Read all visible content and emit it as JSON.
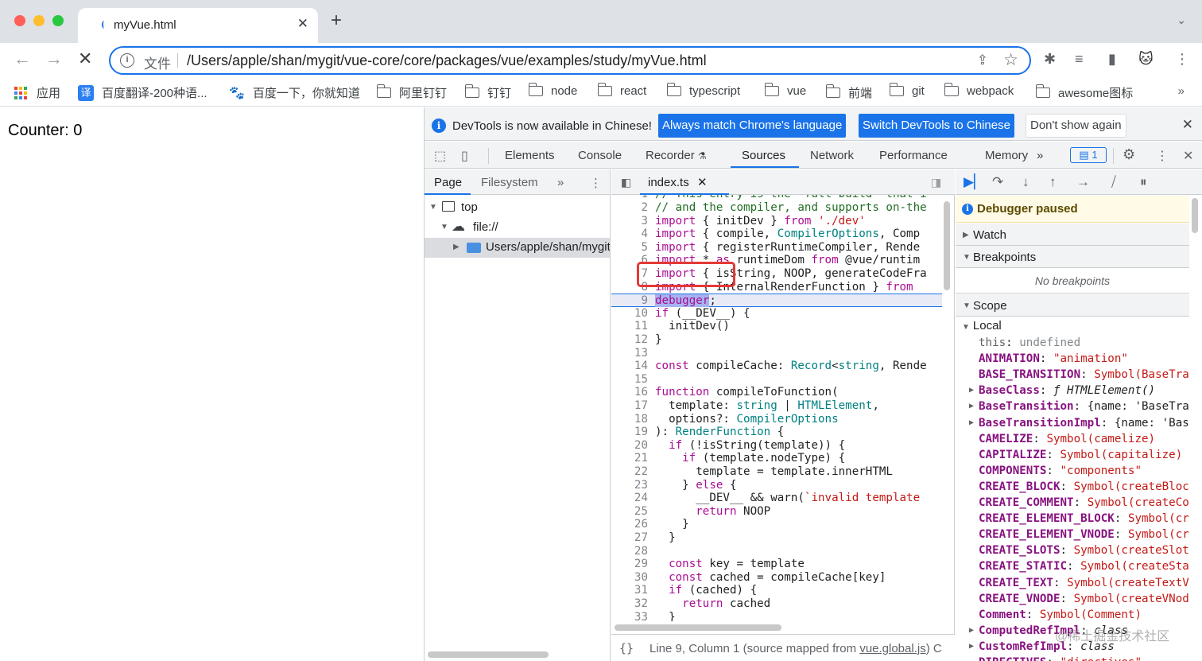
{
  "browser": {
    "tab_title": "myVue.html",
    "url_label": "文件",
    "url": "/Users/apple/shan/mygit/vue-core/core/packages/vue/examples/study/myVue.html"
  },
  "bookmarks": {
    "items": [
      {
        "label": "应用",
        "icon": "apps-grid-icon"
      },
      {
        "label": "百度翻译-200种语...",
        "icon": "fanyi-icon"
      },
      {
        "label": "百度一下，你就知道",
        "icon": "baidu-paw-icon"
      },
      {
        "label": "阿里钉钉",
        "icon": "folder-icon"
      },
      {
        "label": "钉钉",
        "icon": "folder-icon"
      },
      {
        "label": "node",
        "icon": "folder-icon"
      },
      {
        "label": "react",
        "icon": "folder-icon"
      },
      {
        "label": "typescript",
        "icon": "folder-icon"
      },
      {
        "label": "vue",
        "icon": "folder-icon"
      },
      {
        "label": "前端",
        "icon": "folder-icon"
      },
      {
        "label": "git",
        "icon": "folder-icon"
      },
      {
        "label": "webpack",
        "icon": "folder-icon"
      },
      {
        "label": "awesome图标",
        "icon": "folder-icon"
      }
    ],
    "more": "»",
    "fanyi_glyph": "译"
  },
  "page": {
    "counter_text": "Counter: 0"
  },
  "devtools": {
    "infobar": {
      "message": "DevTools is now available in Chinese!",
      "btn_match": "Always match Chrome's language",
      "btn_switch": "Switch DevTools to Chinese",
      "btn_dismiss": "Don't show again"
    },
    "tabs": [
      "Elements",
      "Console",
      "Recorder",
      "Sources",
      "Network",
      "Performance",
      "Memory"
    ],
    "active_tab": "Sources",
    "recorder_icon": "flask-icon",
    "message_count": "1",
    "navigator": {
      "tabs": [
        "Page",
        "Filesystem"
      ],
      "tree": [
        {
          "label": "top",
          "icon": "frame-icon"
        },
        {
          "label": "file://",
          "icon": "cloud-icon"
        },
        {
          "label": "Users/apple/shan/mygit/vue",
          "icon": "folder-icon"
        }
      ]
    },
    "editor": {
      "file_tab": "index.ts",
      "lines": [
        {
          "n": "1",
          "text": "// This entry is the \"full-build\" that i"
        },
        {
          "n": "2",
          "text": "// and the compiler, and supports on-the"
        },
        {
          "n": "3",
          "text": "import { initDev } from './dev'"
        },
        {
          "n": "4",
          "text": "import { compile, CompilerOptions, Comp"
        },
        {
          "n": "5",
          "text": "import { registerRuntimeCompiler, Rende"
        },
        {
          "n": "6",
          "text": "import * as runtimeDom from '@vue/runtim"
        },
        {
          "n": "7",
          "text": "import { isString, NOOP, generateCodeFra"
        },
        {
          "n": "8",
          "text": "import { InternalRenderFunction } from"
        },
        {
          "n": "9",
          "text": "debugger;"
        },
        {
          "n": "10",
          "text": "if (__DEV__) {"
        },
        {
          "n": "11",
          "text": "  initDev()"
        },
        {
          "n": "12",
          "text": "}"
        },
        {
          "n": "13",
          "text": ""
        },
        {
          "n": "14",
          "text": "const compileCache: Record<string, Rende"
        },
        {
          "n": "15",
          "text": ""
        },
        {
          "n": "16",
          "text": "function compileToFunction("
        },
        {
          "n": "17",
          "text": "  template: string | HTMLElement,"
        },
        {
          "n": "18",
          "text": "  options?: CompilerOptions"
        },
        {
          "n": "19",
          "text": "): RenderFunction {"
        },
        {
          "n": "20",
          "text": "  if (!isString(template)) {"
        },
        {
          "n": "21",
          "text": "    if (template.nodeType) {"
        },
        {
          "n": "22",
          "text": "      template = template.innerHTML"
        },
        {
          "n": "23",
          "text": "    } else {"
        },
        {
          "n": "24",
          "text": "      __DEV__ && warn(`invalid template"
        },
        {
          "n": "25",
          "text": "      return NOOP"
        },
        {
          "n": "26",
          "text": "    }"
        },
        {
          "n": "27",
          "text": "  }"
        },
        {
          "n": "28",
          "text": ""
        },
        {
          "n": "29",
          "text": "  const key = template"
        },
        {
          "n": "30",
          "text": "  const cached = compileCache[key]"
        },
        {
          "n": "31",
          "text": "  if (cached) {"
        },
        {
          "n": "32",
          "text": "    return cached"
        },
        {
          "n": "33",
          "text": "  }"
        }
      ],
      "paused_line": "9",
      "status_braces": "{}",
      "status_position": "Line 9, Column 1",
      "status_source_prefix": "(source mapped from ",
      "status_source_link": "vue.global.js",
      "status_source_suffix": ") C"
    },
    "sidebar": {
      "paused_text": "Debugger paused",
      "sections": {
        "watch": "Watch",
        "breakpoints": "Breakpoints",
        "no_breakpoints": "No breakpoints",
        "scope": "Scope",
        "local": "Local"
      },
      "scope_items": [
        {
          "name": "this",
          "value": "undefined",
          "expandable": false,
          "kind": "undef",
          "plain": true
        },
        {
          "name": "ANIMATION",
          "value": "\"animation\"",
          "expandable": false,
          "kind": "str"
        },
        {
          "name": "BASE_TRANSITION",
          "value": "Symbol(BaseTransition)",
          "expandable": false,
          "kind": "sym"
        },
        {
          "name": "BaseClass",
          "value": "ƒ HTMLElement()",
          "expandable": true,
          "kind": "fn"
        },
        {
          "name": "BaseTransition",
          "value": "{name: 'BaseTransition'",
          "expandable": true,
          "kind": "obj"
        },
        {
          "name": "BaseTransitionImpl",
          "value": "{name: 'BaseTransition'",
          "expandable": true,
          "kind": "obj"
        },
        {
          "name": "CAMELIZE",
          "value": "Symbol(camelize)",
          "expandable": false,
          "kind": "sym"
        },
        {
          "name": "CAPITALIZE",
          "value": "Symbol(capitalize)",
          "expandable": false,
          "kind": "sym"
        },
        {
          "name": "COMPONENTS",
          "value": "\"components\"",
          "expandable": false,
          "kind": "str"
        },
        {
          "name": "CREATE_BLOCK",
          "value": "Symbol(createBlock)",
          "expandable": false,
          "kind": "sym"
        },
        {
          "name": "CREATE_COMMENT",
          "value": "Symbol(createComment)",
          "expandable": false,
          "kind": "sym"
        },
        {
          "name": "CREATE_ELEMENT_BLOCK",
          "value": "Symbol(createElementBlock)",
          "expandable": false,
          "kind": "sym"
        },
        {
          "name": "CREATE_ELEMENT_VNODE",
          "value": "Symbol(createElementVNode)",
          "expandable": false,
          "kind": "sym"
        },
        {
          "name": "CREATE_SLOTS",
          "value": "Symbol(createSlots)",
          "expandable": false,
          "kind": "sym"
        },
        {
          "name": "CREATE_STATIC",
          "value": "Symbol(createStaticVNode)",
          "expandable": false,
          "kind": "sym"
        },
        {
          "name": "CREATE_TEXT",
          "value": "Symbol(createTextVNode)",
          "expandable": false,
          "kind": "sym"
        },
        {
          "name": "CREATE_VNODE",
          "value": "Symbol(createVNode)",
          "expandable": false,
          "kind": "sym"
        },
        {
          "name": "Comment",
          "value": "Symbol(Comment)",
          "expandable": false,
          "kind": "sym"
        },
        {
          "name": "ComputedRefImpl",
          "value": "class",
          "expandable": true,
          "kind": "fn"
        },
        {
          "name": "CustomRefImpl",
          "value": "class",
          "expandable": true,
          "kind": "fn"
        },
        {
          "name": "DIRECTIVES",
          "value": "\"directives\"",
          "expandable": false,
          "kind": "str"
        }
      ]
    }
  },
  "watermark": "@稀土掘金技术社区"
}
